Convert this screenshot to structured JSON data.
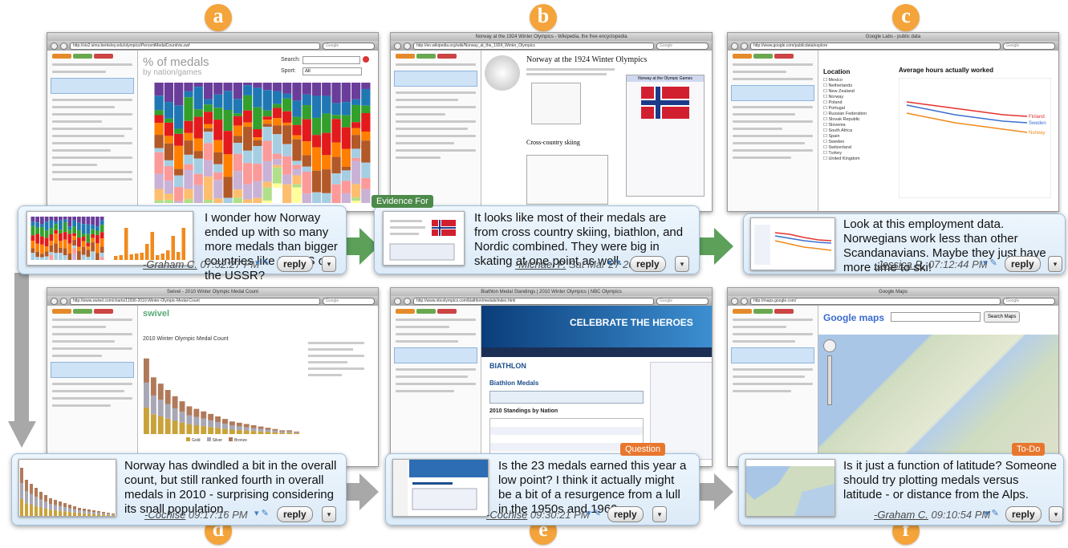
{
  "letters": [
    "a",
    "b",
    "c",
    "d",
    "e",
    "f"
  ],
  "panels": {
    "a": {
      "url": "http://vis2.sims.berkeley.edu/olympics/PercentMedalCount/vis.swf",
      "chart_title": "% of medals",
      "chart_subtitle": "by nation/games",
      "search_label": "Search:",
      "sport_label": "Sport:",
      "sport_value": "All",
      "comment": "I wonder how Norway ended up with so many more medals than bigger countries like the US or the USSR?",
      "author": "-Graham C.",
      "time": "07:52:27 PM",
      "reply": "reply"
    },
    "b": {
      "window_title": "Norway at the 1924 Winter Olympics - Wikipedia, the free encyclopedia",
      "url": "http://en.wikipedia.org/wiki/Norway_at_the_1924_Winter_Olympics",
      "page_title": "Norway at the 1924 Winter Olympics",
      "infobox_title": "Norway at the Olympic Games",
      "section": "Cross-country skiing",
      "tag": "Evidence For",
      "comment": "It looks like most of their medals are from cross country skiing, biathlon, and Nordic combined. They were big in skating at one point as well.",
      "author": "-Michael P.",
      "time": "Sat Mar 27 2010",
      "reply": "reply"
    },
    "c": {
      "window_title": "Google Labs - public data",
      "url": "http://www.google.com/publicdata/explore",
      "location_label": "Location",
      "chart_title": "Average hours actually worked",
      "countries": [
        "Mexico",
        "Netherlands",
        "New Zealand",
        "Norway",
        "Poland",
        "Portugal",
        "Russian Federation",
        "Slovak Republic",
        "Slovenia",
        "South Africa",
        "Spain",
        "Sweden",
        "Switzerland",
        "Turkey",
        "United Kingdom"
      ],
      "series_labels": [
        "Finland",
        "Sweden",
        "Norway"
      ],
      "comment": "Look at this employment data. Norwegians work less than other Scandanavians. Maybe they just have more time to ski!",
      "author": "-Jessica R.",
      "time": "07:12:44 PM",
      "reply": "reply"
    },
    "d": {
      "window_title": "Swivel - 2010 Winter Olympic Medal Count",
      "url": "http://www.swivel.com/charts/11596-2010-Winter-Olympic-Medal-Count",
      "brand": "swivel",
      "chart_title": "2010 Winter Olympic Medal Count",
      "legend": [
        "Gold",
        "Silver",
        "Bronze"
      ],
      "comment": "Norway has dwindled a bit in the overall count, but still ranked fourth in overall medals in 2010 - surprising considering its snall population.",
      "author": "-Cochise",
      "time": "09:17:16 PM",
      "reply": "reply"
    },
    "e": {
      "window_title": "Biathlon Medal Standings | 2010 Winter Olympics | NBC Olympics",
      "url": "http://www.nbcolympics.com/biathlon/medals/index.html",
      "banner": "CELEBRATE THE HEROES",
      "sport": "BIATHLON",
      "medals_title": "Biathlon Medals",
      "standings": "2010 Standings by Nation",
      "tag": "Question",
      "comment": "Is the 23 medals earned this year a low point? I think it actually might be a bit of a resurgence from a lull in the 1950s and 1960s.",
      "author": "-Cochise",
      "time": "09:30:21 PM",
      "reply": "reply"
    },
    "f": {
      "window_title": "Google Maps",
      "url": "http://maps.google.com/",
      "brand": "Google maps",
      "search_button": "Search Maps",
      "tag": "To-Do",
      "comment": "Is it just a function of latitude? Someone should try plotting medals versus latitude - or distance from the Alps.",
      "author": "-Graham C.",
      "time": "09:10:54 PM",
      "reply": "reply"
    }
  },
  "colors": {
    "letter": "#f4a43a",
    "arrow_green": "#5ca05a",
    "arrow_gray": "#a8a8a8",
    "tag_green": "#4c8a4a",
    "tag_orange": "#e8772e",
    "norway_line": "#f08a1c",
    "finland_line": "#e5322d",
    "sweden_line": "#3b6fd0"
  }
}
